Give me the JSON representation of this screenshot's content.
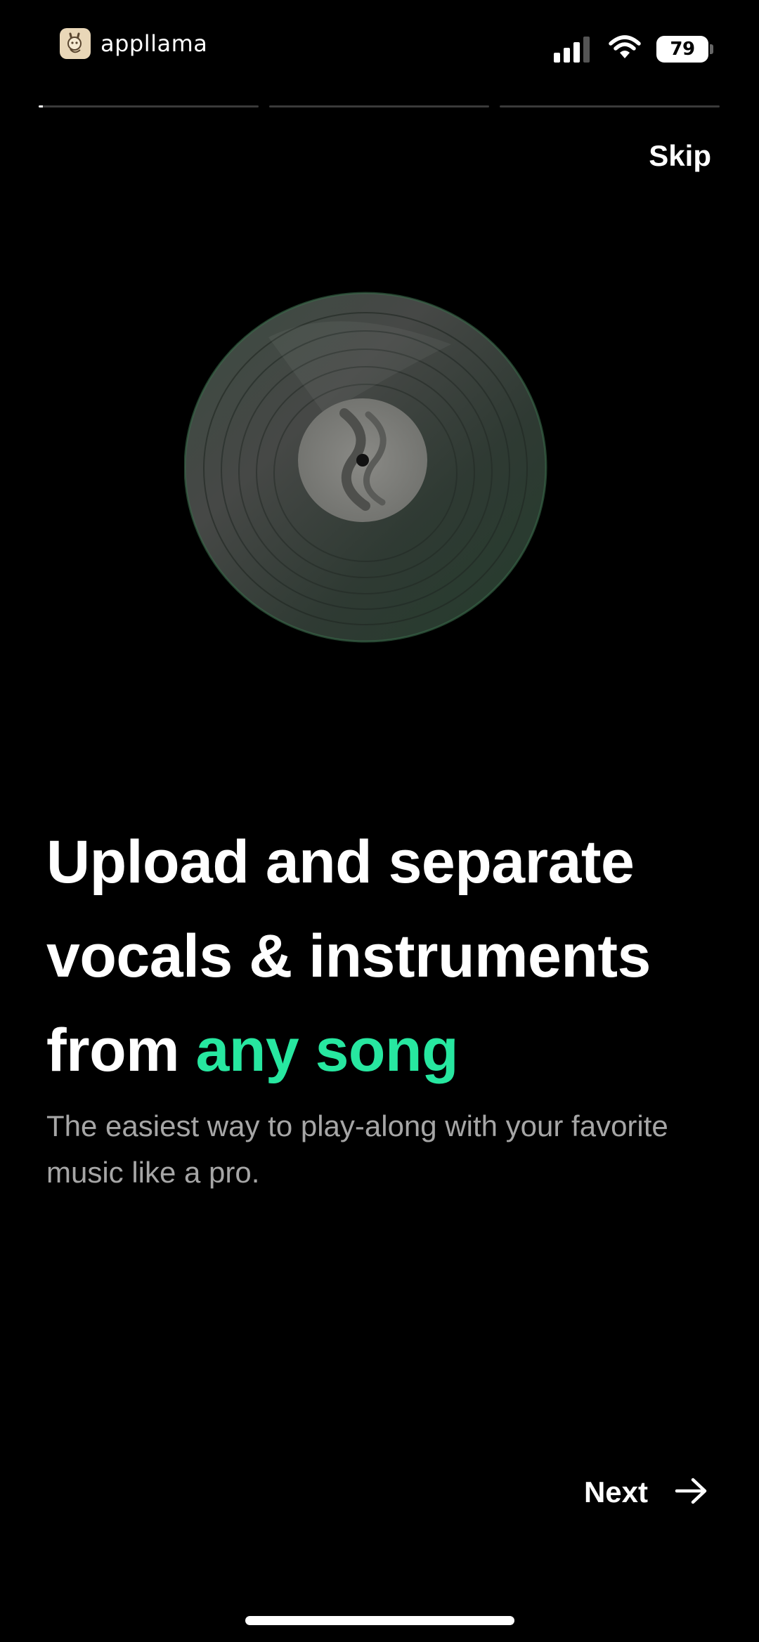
{
  "status_bar": {
    "app_name": "appllama",
    "battery_level": "79",
    "logo_icon": "llama-icon",
    "signal_icon": "cellular-signal-icon",
    "wifi_icon": "wifi-icon",
    "battery_icon": "battery-icon"
  },
  "onboarding": {
    "progress": {
      "total_steps": 3,
      "current_step": 1,
      "current_fill": 0.02
    },
    "skip_label": "Skip",
    "illustration_icon": "vinyl-record-icon",
    "headline_line1": "Upload and separate",
    "headline_line2": "vocals & instruments",
    "headline_line3_prefix": "from ",
    "headline_highlight": "any song",
    "subtitle": "The easiest way to play-along with your favorite music like a pro.",
    "next_label": "Next",
    "next_icon": "arrow-right-icon"
  },
  "colors": {
    "background": "#000000",
    "text": "#ffffff",
    "accent": "#27e7a0",
    "subtitle": "#a6a6a6",
    "progress_track": "#3a3a3a"
  }
}
